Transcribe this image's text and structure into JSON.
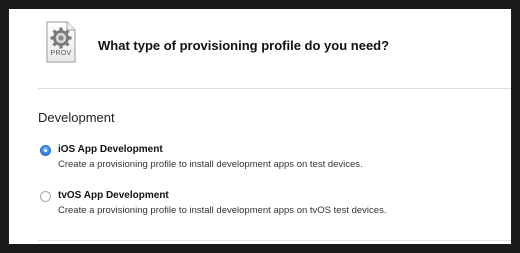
{
  "header": {
    "file_icon_label": "PROV",
    "question": "What type of provisioning profile do you need?"
  },
  "section": {
    "title": "Development"
  },
  "options": [
    {
      "label": "iOS App Development",
      "description": "Create a provisioning profile to install development apps on test devices.",
      "selected": true
    },
    {
      "label": "tvOS App Development",
      "description": "Create a provisioning profile to install development apps on tvOS test devices.",
      "selected": false
    }
  ],
  "colors": {
    "accent": "#2d7fe8",
    "background": "#ffffff",
    "frame": "#1a1a1a"
  },
  "icons": {
    "file_icon": "provisioning-file-icon",
    "gear": "gear-icon"
  }
}
